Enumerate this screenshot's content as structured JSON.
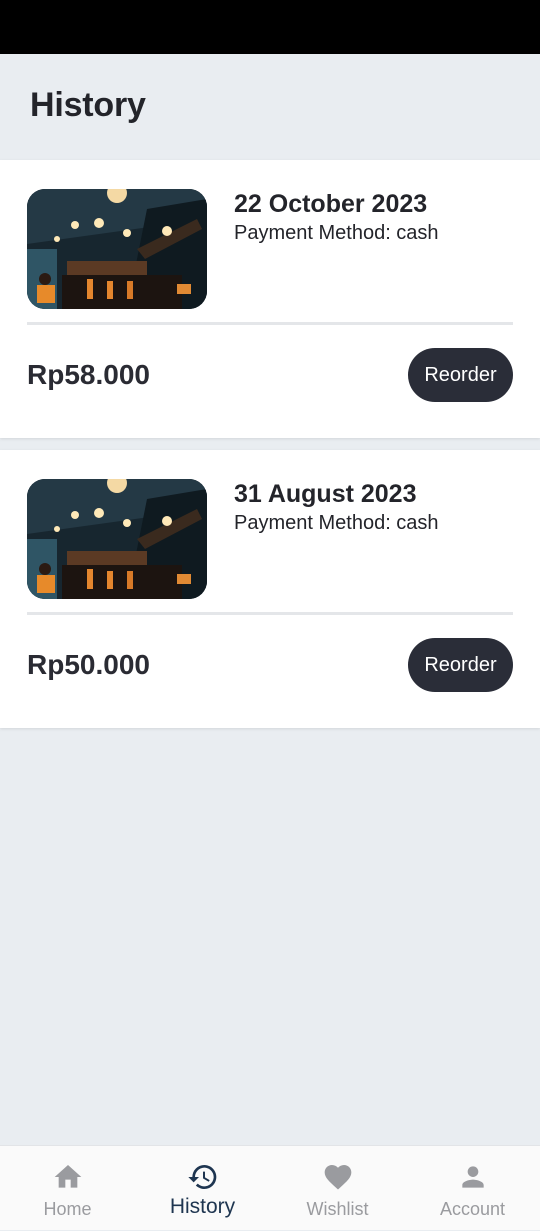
{
  "header": {
    "title": "History"
  },
  "orders": [
    {
      "date": "22 October 2023",
      "payment": "Payment Method: cash",
      "total": "Rp58.000",
      "action": "Reorder"
    },
    {
      "date": "31 August 2023",
      "payment": "Payment Method: cash",
      "total": "Rp50.000",
      "action": "Reorder"
    }
  ],
  "nav": {
    "items": [
      {
        "label": "Home",
        "icon": "home-icon",
        "active": false
      },
      {
        "label": "History",
        "icon": "history-icon",
        "active": true
      },
      {
        "label": "Wishlist",
        "icon": "heart-icon",
        "active": false
      },
      {
        "label": "Account",
        "icon": "person-icon",
        "active": false
      }
    ]
  },
  "colors": {
    "background": "#e9edf1",
    "button": "#2a2d38",
    "active_nav": "#1e3550",
    "inactive_nav": "#9a9b9f"
  }
}
